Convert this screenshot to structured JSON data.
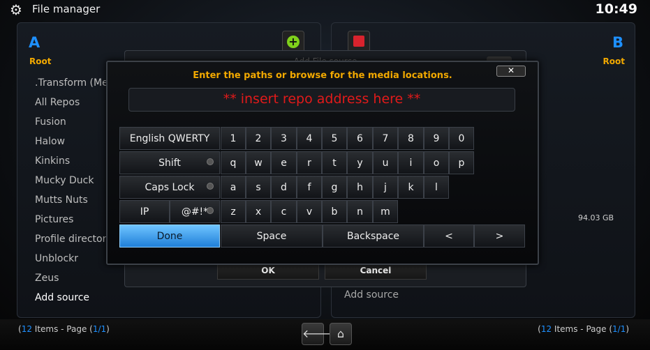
{
  "header": {
    "title": "File manager",
    "clock": "10:49"
  },
  "pane_a": {
    "letter": "A",
    "root": "Root",
    "items": [
      ".Transform (Me",
      "All Repos",
      "Fusion",
      "Halow",
      "Kinkins",
      "Mucky Duck",
      "Mutts Nuts",
      "Pictures",
      "Profile directory",
      "Unblockr",
      "Zeus",
      "Add source"
    ]
  },
  "pane_b": {
    "letter": "B",
    "root": "Root",
    "size": "94.03 GB",
    "add_source": "Add source"
  },
  "back_dialog": {
    "title": "Add File source",
    "ok": "OK",
    "cancel": "Cancel"
  },
  "keyboard": {
    "heading": "Enter the paths or browse for the media locations.",
    "close": "✕",
    "entry_text": "** insert repo address here **",
    "layout_label": "English QWERTY",
    "shift": "Shift",
    "capslock": "Caps Lock",
    "ip": "IP",
    "symbols": "@#!*",
    "done": "Done",
    "space": "Space",
    "backspace": "Backspace",
    "left": "<",
    "right": ">",
    "row1": [
      "1",
      "2",
      "3",
      "4",
      "5",
      "6",
      "7",
      "8",
      "9",
      "0"
    ],
    "row2": [
      "q",
      "w",
      "e",
      "r",
      "t",
      "y",
      "u",
      "i",
      "o",
      "p"
    ],
    "row3": [
      "a",
      "s",
      "d",
      "f",
      "g",
      "h",
      "j",
      "k",
      "l"
    ],
    "row4": [
      "z",
      "x",
      "c",
      "v",
      "b",
      "n",
      "m"
    ]
  },
  "footer": {
    "left": {
      "count": "12",
      "items_label": " Items - Page (",
      "page": "1/1",
      "close_paren": ")"
    },
    "right": {
      "count": "12",
      "items_label": " Items - Page (",
      "page": "1/1",
      "close_paren": ")"
    }
  },
  "colors": {
    "accent": "#1e90ff",
    "heading": "#f2a900",
    "entry_text": "#e21a1a"
  }
}
